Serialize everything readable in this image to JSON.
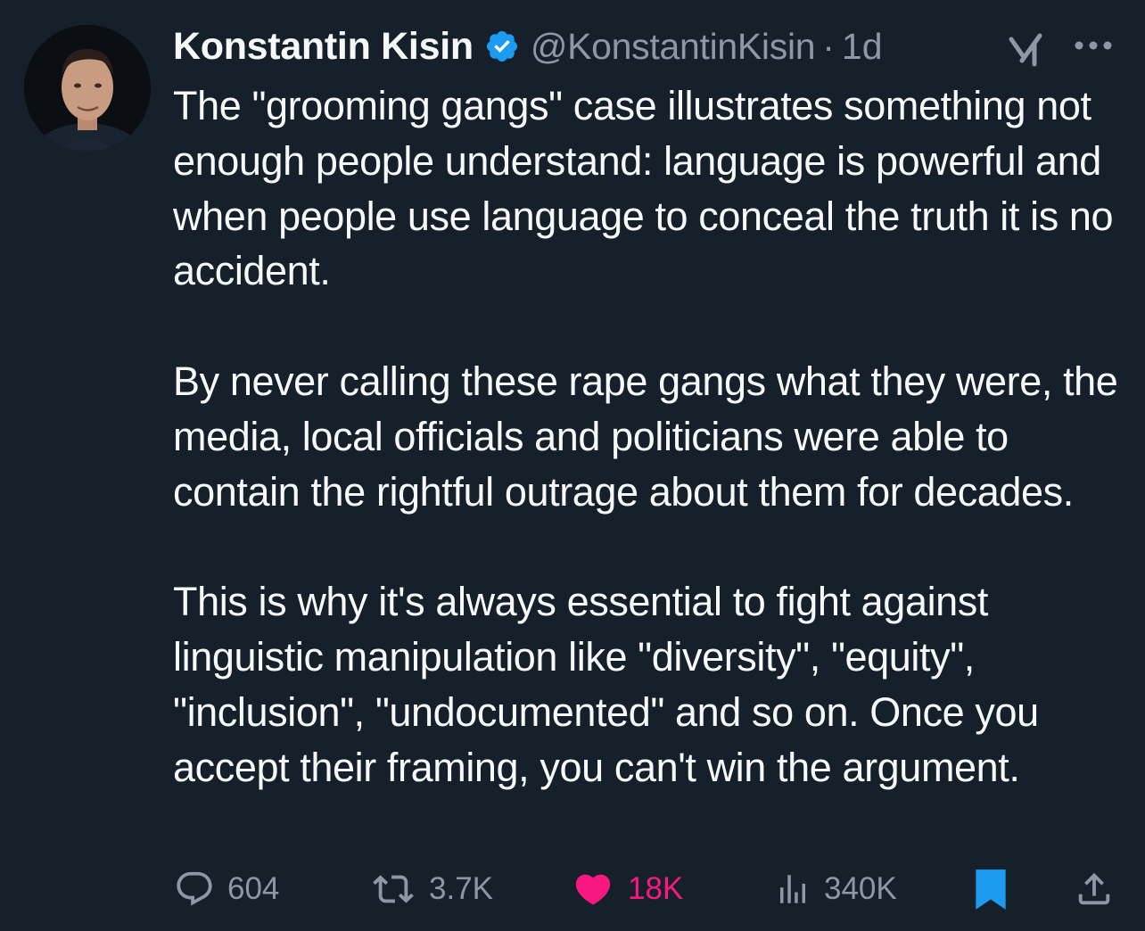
{
  "tweet": {
    "author": {
      "display_name": "Konstantin Kisin",
      "handle": "@KonstantinKisin",
      "verified": true,
      "avatar_icon": "avatar-photo"
    },
    "separator": "·",
    "time": "1d",
    "paragraphs": [
      "The \"grooming gangs\" case illustrates something not enough people understand: language is powerful and when people use language to conceal the truth it is no accident.",
      "By never calling these rape gangs what they were, the media, local officials and politicians were able to contain the rightful outrage about them for decades.",
      "This is why it's always essential to fight against linguistic manipulation like \"diversity\", \"equity\", \"inclusion\", \"undocumented\" and so on. Once you accept their framing, you can't win the argument."
    ],
    "actions": {
      "replies": "604",
      "reposts": "3.7K",
      "likes": "18K",
      "views": "340K"
    },
    "liked": true,
    "bookmarked": true
  },
  "icons": {
    "verified": "verified-badge-icon",
    "grok": "grok-icon",
    "more": "more-icon",
    "reply": "reply-icon",
    "repost": "repost-icon",
    "like": "heart-icon",
    "views": "views-chart-icon",
    "bookmark": "bookmark-icon",
    "share": "share-icon"
  },
  "colors": {
    "background": "#15202b",
    "text_primary": "#f7f9f9",
    "text_secondary": "#8b98a5",
    "verified_blue": "#1d9bf0",
    "like_pink": "#f91880"
  }
}
